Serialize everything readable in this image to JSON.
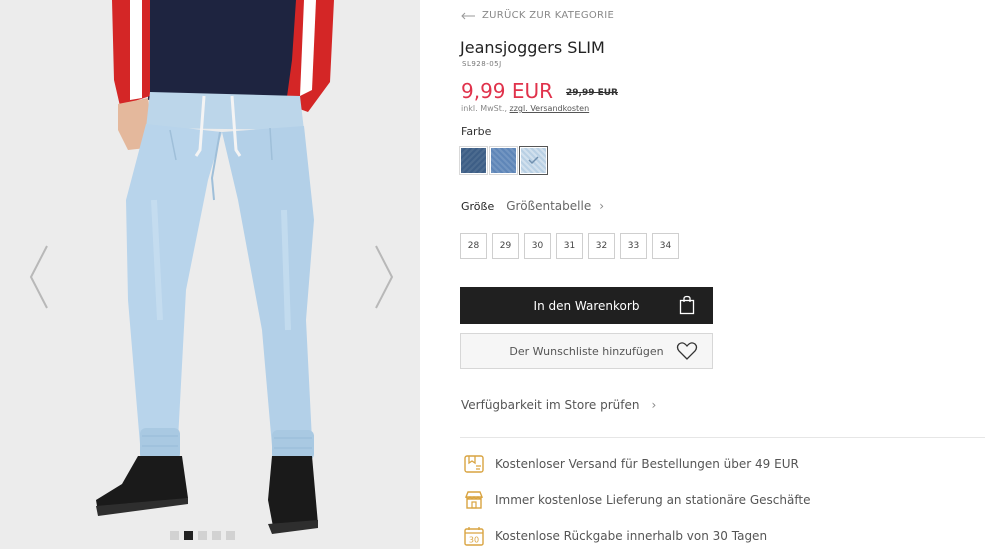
{
  "gallery": {
    "prev_icon": "chevron-left-icon",
    "next_icon": "chevron-right-icon",
    "dots": [
      {
        "active": false
      },
      {
        "active": true
      },
      {
        "active": false
      },
      {
        "active": false
      },
      {
        "active": false
      }
    ]
  },
  "product": {
    "back_label": "ZURÜCK ZUR KATEGORIE",
    "title": "Jeansjoggers SLIM",
    "sku": "SL928-05J",
    "price": "9,99 EUR",
    "old_price": "29,99 EUR",
    "tax_prefix": "inkl. MwSt., ",
    "shipping_link": "zzgl. Versandkosten",
    "color_label": "Farbe",
    "swatches": [
      {
        "color": "#3d5e86",
        "selected": false
      },
      {
        "color": "#5f86b8",
        "selected": false
      },
      {
        "color": "#b9d0e4",
        "selected": true
      }
    ],
    "size_label": "Größe",
    "size_chart_label": "Größentabelle",
    "sizes": [
      "28",
      "29",
      "30",
      "31",
      "32",
      "33",
      "34"
    ],
    "cart_button": "In den Warenkorb",
    "wishlist_button": "Der Wunschliste hinzufügen",
    "store_check": "Verfügbarkeit im Store prüfen",
    "benefits": [
      {
        "icon": "truck-box-icon",
        "text": "Kostenloser Versand für Bestellungen über 49 EUR"
      },
      {
        "icon": "store-icon",
        "text": "Immer kostenlose Lieferung an stationäre Geschäfte"
      },
      {
        "icon": "calendar-30-icon",
        "text": "Kostenlose Rückgabe innerhalb von 30 Tagen"
      }
    ]
  },
  "colors": {
    "price_red": "#e0324b",
    "button_dark": "#202020",
    "benefit_icon": "#d9a441"
  }
}
